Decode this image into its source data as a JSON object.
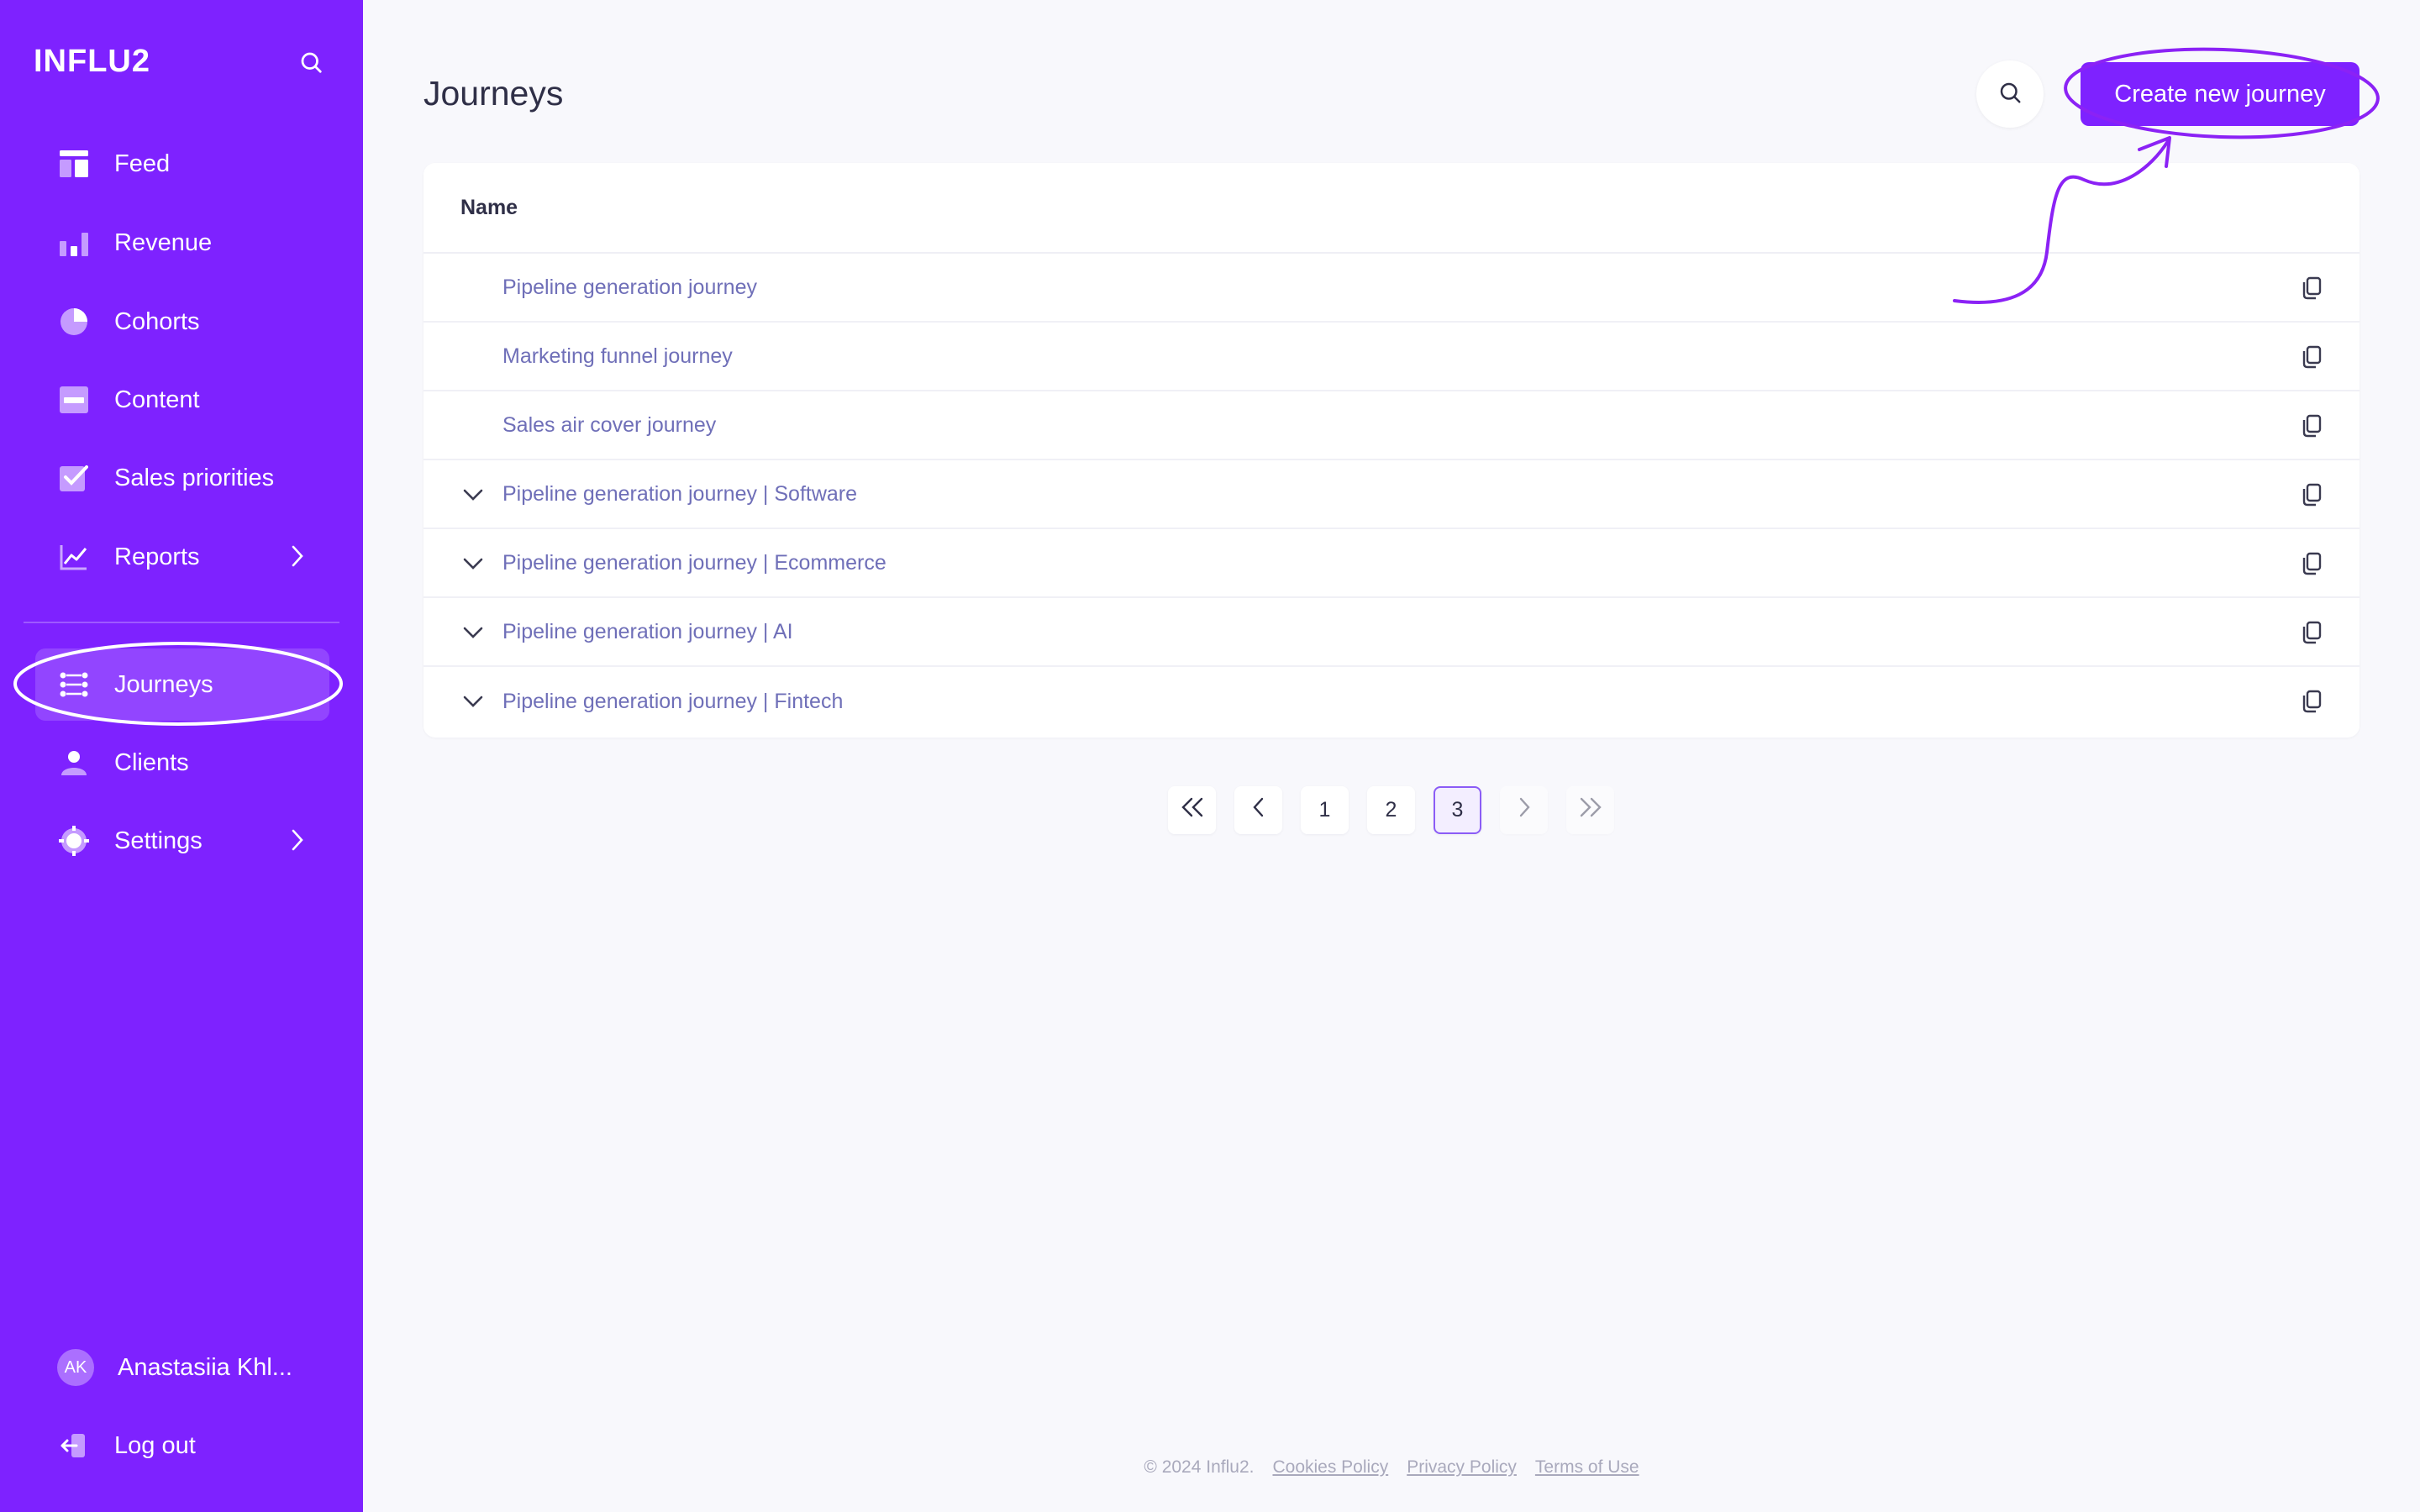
{
  "brand": {
    "logo": "INFLU2",
    "accent": "#7E22FF"
  },
  "sidebar": {
    "items": [
      {
        "label": "Feed",
        "icon": "feed-icon"
      },
      {
        "label": "Revenue",
        "icon": "bar-chart-icon"
      },
      {
        "label": "Cohorts",
        "icon": "pie-chart-icon"
      },
      {
        "label": "Content",
        "icon": "content-icon"
      },
      {
        "label": "Sales priorities",
        "icon": "checkbox-icon"
      },
      {
        "label": "Reports",
        "icon": "line-chart-icon",
        "has_submenu": true
      },
      {
        "label": "Journeys",
        "icon": "journeys-icon",
        "active": true
      },
      {
        "label": "Clients",
        "icon": "user-icon"
      },
      {
        "label": "Settings",
        "icon": "gear-icon",
        "has_submenu": true
      }
    ],
    "user": {
      "initials": "AK",
      "name": "Anastasiia Khl..."
    },
    "logout_label": "Log out"
  },
  "header": {
    "title": "Journeys",
    "create_label": "Create new journey"
  },
  "table": {
    "column_name": "Name",
    "rows": [
      {
        "name": "Pipeline generation journey",
        "expandable": false
      },
      {
        "name": "Marketing funnel journey",
        "expandable": false
      },
      {
        "name": "Sales air cover journey",
        "expandable": false
      },
      {
        "name": "Pipeline generation journey | Software",
        "expandable": true
      },
      {
        "name": "Pipeline generation journey | Ecommerce",
        "expandable": true
      },
      {
        "name": "Pipeline generation journey | AI",
        "expandable": true
      },
      {
        "name": "Pipeline generation journey | Fintech",
        "expandable": true
      }
    ]
  },
  "pagination": {
    "pages": [
      "1",
      "2",
      "3"
    ],
    "current": "3"
  },
  "footer": {
    "copyright": "© 2024 Influ2.",
    "cookies": "Cookies Policy",
    "privacy": "Privacy Policy",
    "terms": "Terms of Use"
  }
}
